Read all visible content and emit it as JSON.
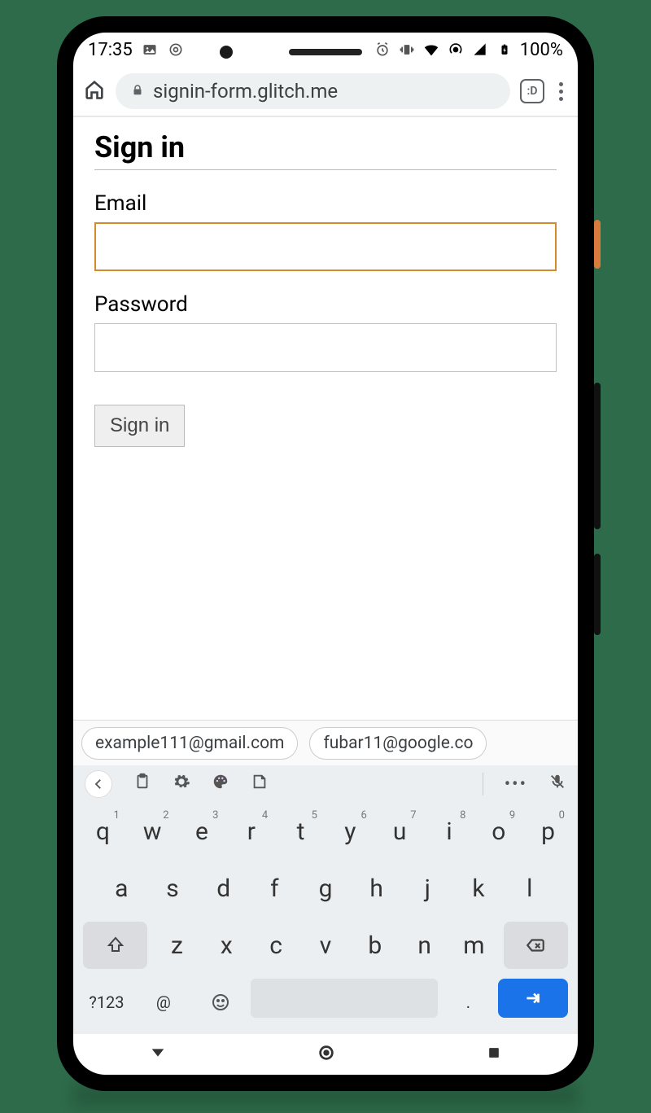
{
  "status": {
    "time": "17:35",
    "battery": "100%"
  },
  "browser": {
    "url": "signin-form.glitch.me",
    "tabcount": ":D"
  },
  "page": {
    "title": "Sign in",
    "email_label": "Email",
    "password_label": "Password",
    "submit_label": "Sign in"
  },
  "suggestions": [
    "example111@gmail.com",
    "fubar11@google.co"
  ],
  "keyboard": {
    "row1": [
      {
        "k": "q",
        "n": "1"
      },
      {
        "k": "w",
        "n": "2"
      },
      {
        "k": "e",
        "n": "3"
      },
      {
        "k": "r",
        "n": "4"
      },
      {
        "k": "t",
        "n": "5"
      },
      {
        "k": "y",
        "n": "6"
      },
      {
        "k": "u",
        "n": "7"
      },
      {
        "k": "i",
        "n": "8"
      },
      {
        "k": "o",
        "n": "9"
      },
      {
        "k": "p",
        "n": "0"
      }
    ],
    "row2": [
      "a",
      "s",
      "d",
      "f",
      "g",
      "h",
      "j",
      "k",
      "l"
    ],
    "row3": [
      "z",
      "x",
      "c",
      "v",
      "b",
      "n",
      "m"
    ],
    "alt": "?123",
    "at": "@",
    "dot": "."
  }
}
